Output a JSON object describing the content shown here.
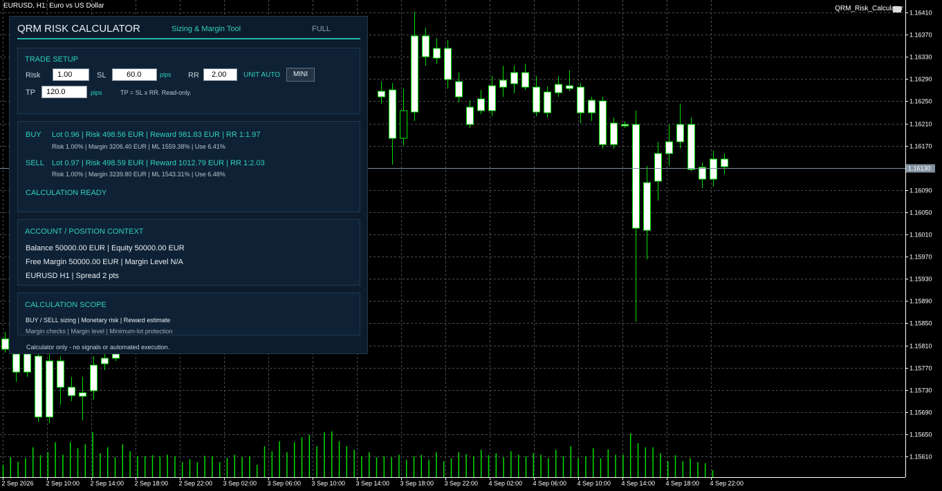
{
  "chart": {
    "title": "EURUSD, H1:  Euro vs US Dollar",
    "ea_name": "QRM_Risk_Calculator",
    "current_price": "1.16130",
    "price_ticks": [
      "1.16410",
      "1.16370",
      "1.16330",
      "1.16290",
      "1.16250",
      "1.16210",
      "1.16170",
      "1.16130",
      "1.16090",
      "1.16050",
      "1.16010",
      "1.15970",
      "1.15930",
      "1.15890",
      "1.15850",
      "1.15810",
      "1.15770",
      "1.15730",
      "1.15690",
      "1.15650",
      "1.15610"
    ],
    "time_ticks": [
      "2 Sep 2026",
      "2 Sep 10:00",
      "2 Sep 14:00",
      "2 Sep 18:00",
      "2 Sep 22:00",
      "3 Sep 02:00",
      "3 Sep 06:00",
      "3 Sep 10:00",
      "3 Sep 14:00",
      "3 Sep 18:00",
      "3 Sep 22:00",
      "4 Sep 02:00",
      "4 Sep 06:00",
      "4 Sep 10:00",
      "4 Sep 14:00",
      "4 Sep 18:00",
      "4 Sep 22:00"
    ],
    "colors": {
      "background": "#000000",
      "grid": "#4a4f55",
      "bull_body": "#ffffff",
      "bear_body": "#000000",
      "wick": "#00e000",
      "volume": "#00e000",
      "price_line": "#8090a0",
      "price_label_bg": "#8090a0"
    }
  },
  "panel": {
    "title": "QRM RISK CALCULATOR",
    "subtitle": "Sizing & Margin Tool",
    "mode": "FULL",
    "trade_setup": {
      "title": "TRADE SETUP",
      "risk_label": "Risk",
      "risk_value": "1.00",
      "sl_label": "SL",
      "sl_value": "60.0",
      "sl_unit": "pips",
      "rr_label": "RR",
      "rr_value": "2.00",
      "unit_mode": "UNIT AUTO",
      "mini_button": "MINI",
      "tp_label": "TP",
      "tp_value": "120.0",
      "tp_unit": "pips",
      "tp_note": "TP = SL x RR. Read-only."
    },
    "results": {
      "buy_label": "BUY",
      "buy_main": "Lot 0.96 | Risk 498.56 EUR | Reward 981.83 EUR | RR 1:1.97",
      "buy_sub": "Risk 1.00% | Margin 3206.40 EUR | ML 1559.38% | Use 6.41%",
      "sell_label": "SELL",
      "sell_main": "Lot 0.97 | Risk 498.59 EUR | Reward 1012.79 EUR | RR 1:2.03",
      "sell_sub": "Risk 1.00% | Margin 3239.80 EUR | ML 1543.31% | Use 6.48%",
      "status": "CALCULATION READY"
    },
    "account": {
      "title": "ACCOUNT / POSITION CONTEXT",
      "line1": "Balance 50000.00 EUR | Equity 50000.00 EUR",
      "line2": "Free Margin 50000.00 EUR | Margin Level N/A",
      "line3": "EURUSD H1 | Spread 2 pts"
    },
    "scope": {
      "title": "CALCULATION SCOPE",
      "line1": "BUY / SELL sizing  |  Monetary risk  |  Reward estimate",
      "line2": "Margin checks  |  Margin level  |  Minimum-lot protection"
    },
    "footer": "Calculator only - no signals or automated execution."
  }
}
